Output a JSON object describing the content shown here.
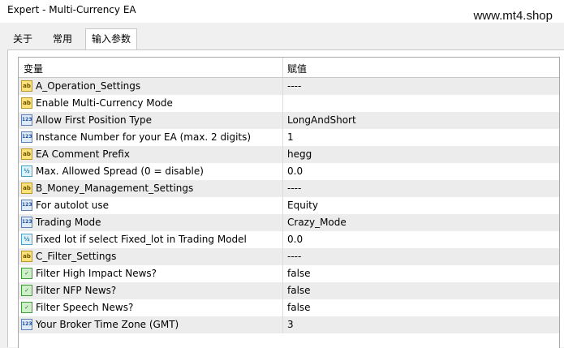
{
  "window": {
    "title": "Expert - Multi-Currency EA",
    "watermark": "www.mt4.shop"
  },
  "tabs": [
    {
      "label": "关于",
      "active": false
    },
    {
      "label": "常用",
      "active": false
    },
    {
      "label": "输入参数",
      "active": true
    }
  ],
  "table": {
    "columns": [
      "变量",
      "赋值"
    ],
    "rows": [
      {
        "icon": "string-type-icon",
        "name": "A_Operation_Settings",
        "value": "----"
      },
      {
        "icon": "string-type-icon",
        "name": "Enable Multi-Currency Mode",
        "value": ""
      },
      {
        "icon": "integer-type-icon",
        "name": "Allow First Position Type",
        "value": "LongAndShort"
      },
      {
        "icon": "integer-type-icon",
        "name": "Instance Number for your EA (max. 2 digits)",
        "value": "1"
      },
      {
        "icon": "string-type-icon",
        "name": "EA Comment Prefix",
        "value": "hegg"
      },
      {
        "icon": "double-type-icon",
        "name": "Max. Allowed Spread (0 = disable)",
        "value": "0.0"
      },
      {
        "icon": "string-type-icon",
        "name": "B_Money_Management_Settings",
        "value": "----"
      },
      {
        "icon": "integer-type-icon",
        "name": "For autolot use",
        "value": "Equity"
      },
      {
        "icon": "integer-type-icon",
        "name": "Trading Mode",
        "value": "Crazy_Mode"
      },
      {
        "icon": "double-type-icon",
        "name": "Fixed lot if select Fixed_lot in Trading Model",
        "value": "0.0"
      },
      {
        "icon": "string-type-icon",
        "name": "C_Filter_Settings",
        "value": "----"
      },
      {
        "icon": "bool-type-icon",
        "name": "Filter High Impact News?",
        "value": "false"
      },
      {
        "icon": "bool-type-icon",
        "name": "Filter NFP News?",
        "value": "false"
      },
      {
        "icon": "bool-type-icon",
        "name": "Filter Speech News?",
        "value": "false"
      },
      {
        "icon": "integer-type-icon",
        "name": "Your Broker Time Zone (GMT)",
        "value": "3"
      }
    ]
  }
}
